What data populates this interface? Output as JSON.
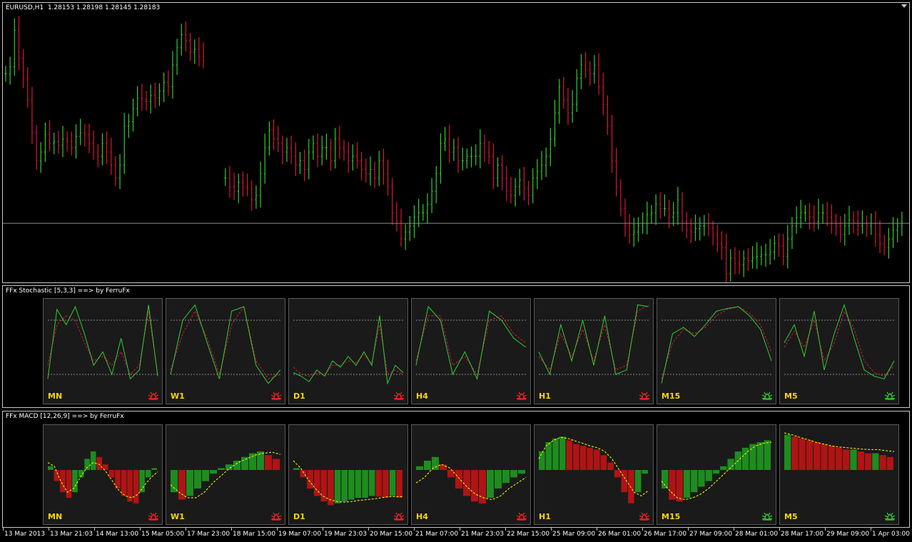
{
  "chart": {
    "symbol_label": "EURUSD,H1  1.28153 1.28198 1.28145 1.28183",
    "bid_line": 1.2818,
    "colors": {
      "up": "#32cd32",
      "down": "#dc143c",
      "grid": "#c8c8c8"
    },
    "price_range": [
      1.2755,
      1.306
    ],
    "candles": [
      1.299,
      1.2998,
      1.304,
      1.3008,
      1.2985,
      1.296,
      1.2922,
      1.289,
      1.29,
      1.292,
      1.291,
      1.2912,
      1.2908,
      1.2915,
      1.2912,
      1.2905,
      1.2918,
      1.2922,
      1.292,
      1.291,
      1.29,
      1.2895,
      1.291,
      1.29,
      1.2885,
      1.287,
      1.2885,
      1.293,
      1.2935,
      1.295,
      1.2962,
      1.296,
      1.2958,
      1.2965,
      1.2962,
      1.297,
      1.298,
      1.2975,
      1.3,
      1.302,
      1.3035,
      1.3028,
      1.3015,
      1.3018,
      1.301,
      1.3005,
      null,
      null,
      null,
      null,
      1.287,
      1.286,
      1.2855,
      1.2865,
      1.286,
      1.2858,
      1.2845,
      1.285,
      1.2875,
      1.2905,
      1.2925,
      1.2915,
      1.291,
      1.29,
      1.2905,
      1.2895,
      1.2885,
      1.289,
      1.288,
      1.29,
      1.291,
      1.2895,
      1.2905,
      1.2905,
      1.289,
      1.2915,
      1.2905,
      1.29,
      1.289,
      1.2895,
      1.289,
      1.288,
      1.2875,
      1.288,
      1.287,
      1.289,
      1.2875,
      1.286,
      1.283,
      1.282,
      1.28,
      1.2808,
      1.2815,
      1.2825,
      1.283,
      1.283,
      1.284,
      1.2855,
      1.2875,
      1.291,
      1.2915,
      1.29,
      1.2905,
      1.289,
      1.289,
      1.2895,
      1.2895,
      1.2895,
      1.291,
      1.29,
      1.2895,
      1.287,
      1.2885,
      1.287,
      1.2855,
      1.285,
      1.286,
      1.2868,
      1.2858,
      1.285,
      1.287,
      1.2878,
      1.2885,
      1.2895,
      1.2915,
      1.2945,
      1.2975,
      1.296,
      1.2945,
      1.2955,
      1.2985,
      1.3,
      1.2995,
      1.299,
      1.3,
      1.2975,
      1.2955,
      1.293,
      1.289,
      1.286,
      1.2835,
      1.2815,
      1.2805,
      1.2808,
      1.2815,
      1.2818,
      1.2828,
      1.283,
      1.284,
      1.2835,
      1.2835,
      1.2825,
      1.283,
      1.2845,
      1.282,
      1.281,
      1.2808,
      1.2812,
      1.2815,
      1.2815,
      1.2812,
      1.2805,
      1.2795,
      1.279,
      1.276,
      1.2778,
      1.2772,
      1.277,
      1.2778,
      1.2775,
      1.2778,
      1.278,
      1.2782,
      1.2782,
      1.2785,
      1.2795,
      1.2792,
      1.278,
      1.28,
      1.2815,
      1.2825,
      1.283,
      1.283,
      1.2825,
      1.282,
      1.283,
      1.283,
      1.2825,
      1.282,
      1.2815,
      1.2805,
      1.2815,
      1.2822,
      1.282,
      1.2815,
      1.2818,
      1.2815,
      1.2818,
      1.2805,
      1.2795,
      1.279,
      1.28,
      1.281,
      1.2815,
      1.282
    ]
  },
  "stochastic": {
    "title": "FFx Stochastic [5,3,3] ==> by FerruFx",
    "panels": [
      {
        "tf": "MN",
        "alert": "down",
        "k": [
          0.15,
          0.92,
          0.75,
          0.95,
          0.65,
          0.3,
          0.45,
          0.2,
          0.6,
          0.15,
          0.25,
          0.97,
          0.18
        ],
        "d": [
          0.3,
          0.75,
          0.85,
          0.8,
          0.55,
          0.35,
          0.4,
          0.3,
          0.45,
          0.2,
          0.3,
          0.9,
          0.2
        ]
      },
      {
        "tf": "W1",
        "alert": "down",
        "k": [
          0.2,
          0.8,
          0.97,
          0.55,
          0.15,
          0.9,
          0.95,
          0.3,
          0.1,
          0.25
        ],
        "d": [
          0.25,
          0.65,
          0.9,
          0.6,
          0.2,
          0.75,
          0.95,
          0.35,
          0.15,
          0.2
        ]
      },
      {
        "tf": "D1",
        "alert": "down",
        "k": [
          0.22,
          0.18,
          0.12,
          0.25,
          0.18,
          0.35,
          0.28,
          0.4,
          0.3,
          0.45,
          0.3,
          0.85,
          0.1,
          0.3,
          0.22
        ],
        "d": [
          0.28,
          0.2,
          0.18,
          0.22,
          0.2,
          0.3,
          0.3,
          0.35,
          0.33,
          0.42,
          0.32,
          0.75,
          0.2,
          0.25,
          0.2
        ]
      },
      {
        "tf": "H4",
        "alert": "down",
        "k": [
          0.3,
          0.95,
          0.8,
          0.2,
          0.45,
          0.15,
          0.9,
          0.8,
          0.6,
          0.5
        ],
        "d": [
          0.35,
          0.85,
          0.85,
          0.3,
          0.4,
          0.2,
          0.8,
          0.85,
          0.65,
          0.55
        ],
        "ext": 0
      },
      {
        "tf": "H1",
        "alert": "down",
        "k": [
          0.45,
          0.2,
          0.75,
          0.35,
          0.8,
          0.3,
          0.85,
          0.2,
          0.25,
          0.97,
          0.95
        ],
        "d": [
          0.4,
          0.25,
          0.65,
          0.4,
          0.7,
          0.35,
          0.75,
          0.25,
          0.3,
          0.9,
          0.97
        ]
      },
      {
        "tf": "M15",
        "alert": "up",
        "k": [
          0.1,
          0.65,
          0.72,
          0.62,
          0.75,
          0.9,
          0.93,
          0.95,
          0.85,
          0.7,
          0.35
        ],
        "d": [
          0.15,
          0.55,
          0.7,
          0.65,
          0.72,
          0.85,
          0.92,
          0.95,
          0.88,
          0.75,
          0.45
        ]
      },
      {
        "tf": "M5",
        "alert": "up",
        "k": [
          0.55,
          0.75,
          0.4,
          0.9,
          0.25,
          0.65,
          0.97,
          0.6,
          0.25,
          0.18,
          0.15,
          0.35
        ],
        "d": [
          0.5,
          0.68,
          0.5,
          0.8,
          0.35,
          0.55,
          0.9,
          0.7,
          0.35,
          0.22,
          0.18,
          0.3
        ]
      }
    ]
  },
  "macd": {
    "title": "FFx MACD [12,26,9] ==> by FerruFx",
    "panels": [
      {
        "tf": "MN",
        "alert": "down",
        "bars": [
          0.1,
          -0.3,
          -0.6,
          -0.75,
          -0.6,
          -0.2,
          0.3,
          0.5,
          0.35,
          0.15,
          -0.2,
          -0.5,
          -0.7,
          -0.85,
          -0.9,
          -0.6,
          -0.2,
          0.05
        ],
        "signal": [
          0.2,
          0.1,
          -0.3,
          -0.6,
          -0.5,
          -0.2,
          0.05,
          0.2,
          0.15,
          -0.05,
          -0.3,
          -0.55,
          -0.7,
          -0.75,
          -0.65,
          -0.4,
          -0.2,
          -0.05
        ]
      },
      {
        "tf": "W1",
        "alert": "down",
        "bars": [
          -0.6,
          -0.8,
          -0.7,
          -0.5,
          -0.3,
          -0.1,
          0.05,
          0.15,
          0.25,
          0.35,
          0.45,
          0.5,
          0.4,
          0.3
        ],
        "signal": [
          -0.4,
          -0.6,
          -0.75,
          -0.75,
          -0.6,
          -0.35,
          -0.15,
          0.05,
          0.2,
          0.3,
          0.4,
          0.45,
          0.48,
          0.42
        ]
      },
      {
        "tf": "D1",
        "alert": "down",
        "bars": [
          0.05,
          -0.2,
          -0.5,
          -0.7,
          -0.85,
          -0.95,
          -0.9,
          -0.85,
          -0.8,
          -0.75,
          -0.75,
          -0.7,
          -0.72,
          -0.75,
          -0.7,
          -0.75
        ],
        "signal": [
          0.25,
          0.05,
          -0.25,
          -0.5,
          -0.7,
          -0.8,
          -0.85,
          -0.87,
          -0.85,
          -0.82,
          -0.8,
          -0.78,
          -0.75,
          -0.72,
          -0.72,
          -0.72
        ]
      },
      {
        "tf": "H4",
        "alert": "down",
        "bars": [
          0.1,
          0.25,
          0.35,
          0.15,
          -0.2,
          -0.5,
          -0.7,
          -0.85,
          -0.9,
          -0.75,
          -0.5,
          -0.35,
          -0.2,
          -0.1
        ],
        "signal": [
          -0.35,
          -0.2,
          0.05,
          0.15,
          0.05,
          -0.2,
          -0.45,
          -0.65,
          -0.75,
          -0.8,
          -0.7,
          -0.5,
          -0.35,
          -0.2
        ]
      },
      {
        "tf": "H1",
        "alert": "down",
        "bars": [
          0.5,
          0.75,
          0.85,
          0.9,
          0.8,
          0.7,
          0.65,
          0.6,
          0.55,
          0.4,
          0.2,
          -0.2,
          -0.6,
          -0.9,
          -0.6,
          -0.1
        ],
        "signal": [
          0.3,
          0.65,
          0.8,
          0.88,
          0.85,
          0.78,
          0.72,
          0.65,
          0.6,
          0.5,
          0.3,
          0.0,
          -0.3,
          -0.6,
          -0.7,
          -0.55
        ]
      },
      {
        "tf": "M15",
        "alert": "up",
        "bars": [
          -0.5,
          -0.8,
          -0.85,
          -0.75,
          -0.6,
          -0.45,
          -0.3,
          -0.1,
          0.1,
          0.3,
          0.5,
          0.6,
          0.7,
          0.75,
          0.8
        ],
        "signal": [
          -0.3,
          -0.55,
          -0.75,
          -0.8,
          -0.75,
          -0.65,
          -0.5,
          -0.3,
          -0.1,
          0.1,
          0.3,
          0.5,
          0.65,
          0.72,
          0.75
        ]
      },
      {
        "tf": "M5",
        "alert": "up",
        "bars": [
          0.95,
          0.9,
          0.85,
          0.8,
          0.75,
          0.7,
          0.65,
          0.6,
          0.55,
          0.55,
          0.5,
          0.45,
          0.45,
          0.4,
          0.35
        ],
        "signal": [
          1.0,
          0.95,
          0.88,
          0.82,
          0.75,
          0.7,
          0.65,
          0.62,
          0.6,
          0.58,
          0.56,
          0.55,
          0.55,
          0.52,
          0.5
        ]
      }
    ]
  },
  "time_axis": {
    "labels": [
      "13 Mar 2013",
      "13 Mar 21:03",
      "14 Mar 13:00",
      "15 Mar 05:00",
      "17 Mar 23:00",
      "18 Mar 15:00",
      "19 Mar 07:00",
      "19 Mar 23:03",
      "20 Mar 15:00",
      "21 Mar 07:00",
      "21 Mar 23:03",
      "22 Mar 15:00",
      "25 Mar 09:00",
      "26 Mar 01:00",
      "26 Mar 17:00",
      "27 Mar 09:00",
      "28 Mar 01:00",
      "28 Mar 17:00",
      "29 Mar 09:00",
      "1 Apr 03:00"
    ]
  }
}
